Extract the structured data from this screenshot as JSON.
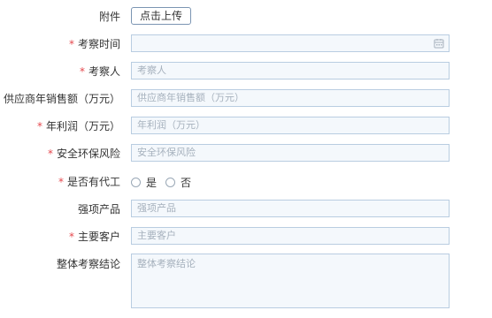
{
  "form": {
    "attachment": {
      "label": "附件",
      "button_label": "点击上传"
    },
    "inspection_time": {
      "label": "考察时间",
      "value": ""
    },
    "inspector": {
      "label": "考察人",
      "placeholder": "考察人"
    },
    "supplier_sales": {
      "label": "供应商年销售额（万元）",
      "placeholder": "供应商年销售额（万元）"
    },
    "annual_profit": {
      "label": "年利润（万元）",
      "placeholder": "年利润（万元）"
    },
    "safety_risk": {
      "label": "安全环保风险",
      "placeholder": "安全环保风险"
    },
    "has_agent": {
      "label": "是否有代工",
      "options": [
        "是",
        "否"
      ]
    },
    "strong_products": {
      "label": "强项产品",
      "placeholder": "强项产品"
    },
    "main_customers": {
      "label": "主要客户",
      "placeholder": "主要客户"
    },
    "overall_conclusion": {
      "label": "整体考察结论",
      "placeholder": "整体考察结论"
    }
  },
  "required_marker": "*",
  "icons": {
    "date_picker": "calendar-icon"
  },
  "colors": {
    "required": "#e5484d",
    "input_border": "#b9cde1",
    "input_bg": "#f4f8fc",
    "placeholder": "#a6b1bd"
  }
}
